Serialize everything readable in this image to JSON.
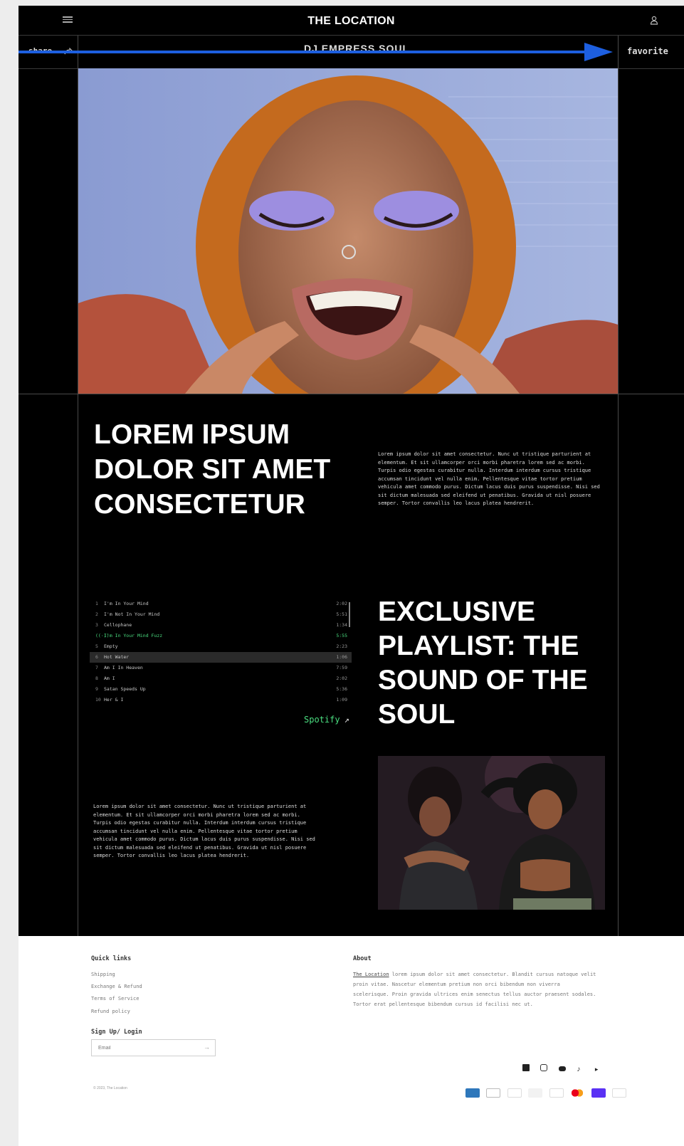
{
  "header": {
    "brand": "THE LOCATION",
    "share_label": "share",
    "page_title": "DJ EMPRESS SOUL",
    "favorite_label": "favorite"
  },
  "main": {
    "headline": "LOREM IPSUM DOLOR SIT AMET CONSECTETUR",
    "intro_text": "Lorem ipsum dolor sit amet consectetur. Nunc ut tristique parturient at elementum. Et sit ullamcorper orci morbi pharetra lorem sed ac morbi. Turpis odio egestas curabitur nulla. Interdum interdum cursus tristique accumsan tincidunt vel nulla enim. Pellentesque vitae tortor pretium vehicula amet commodo purus. Dictum lacus duis purus suspendisse. Nisi sed sit dictum malesuada sed eleifend ut penatibus. Gravida ut nisl posuere semper. Tortor convallis leo lacus platea hendrerit.",
    "playlist_title": "EXCLUSIVE PLAYLIST: THE SOUND OF THE SOUL",
    "body_text": "Lorem ipsum dolor sit amet consectetur. Nunc ut tristique parturient at elementum. Et sit ullamcorper orci morbi pharetra lorem sed ac morbi. Turpis odio egestas curabitur nulla. Interdum interdum cursus tristique accumsan tincidunt vel nulla enim. Pellentesque vitae tortor pretium vehicula amet commodo purus. Dictum lacus duis purus suspendisse. Nisi sed sit dictum malesuada sed eleifend ut penatibus. Gravida ut nisl posuere semper. Tortor convallis leo lacus platea hendrerit.",
    "spotify_label": "Spotify",
    "tracks": [
      {
        "num": "1",
        "title": "I'm In Your Mind",
        "duration": "2:02"
      },
      {
        "num": "2",
        "title": "I'm Not In Your Mind",
        "duration": "5:51"
      },
      {
        "num": "3",
        "title": "Cellophane",
        "duration": "1:34"
      },
      {
        "num": "((·))",
        "title": "I'm In Your Mind Fuzz",
        "duration": "5:55",
        "state": "playing"
      },
      {
        "num": "5",
        "title": "Empty",
        "duration": "2:23"
      },
      {
        "num": "6",
        "title": "Hot Water",
        "duration": "1:06",
        "state": "selected"
      },
      {
        "num": "7",
        "title": "Am I In Heaven",
        "duration": "7:59"
      },
      {
        "num": "8",
        "title": "Am I",
        "duration": "2:02"
      },
      {
        "num": "9",
        "title": "Satan Speeds Up",
        "duration": "5:36"
      },
      {
        "num": "10",
        "title": "Her & I",
        "duration": "1:09"
      }
    ],
    "accent_color": "#4ade80"
  },
  "footer": {
    "quick_links_heading": "Quick links",
    "links": [
      "Shipping",
      "Exchange & Refund",
      "Terms of Service",
      "Refund policy"
    ],
    "signup_heading": "Sign Up/ Login",
    "email_placeholder": "Email",
    "about_heading": "About",
    "about_link": "The Location",
    "about_text": " lorem ipsum dolor sit amet consectetur. Blandit cursus natoque velit proin vitae. Nascetur elementum pretium non orci bibendum non viverra scelerisque. Proin gravida ultrices enim senectus tellus auctor praesent sodales. Tortor erat pellentesque bibendum cursus id facilisi nec ut.",
    "copyright": "© 2023, The Location",
    "social_icons": [
      "facebook-icon",
      "instagram-icon",
      "youtube-icon",
      "tiktok-icon",
      "twitter-icon"
    ],
    "payment_icons": [
      "amex-icon",
      "apple-pay-icon",
      "diners-icon",
      "discover-icon",
      "google-pay-icon",
      "mastercard-icon",
      "shop-pay-icon",
      "visa-icon"
    ]
  }
}
